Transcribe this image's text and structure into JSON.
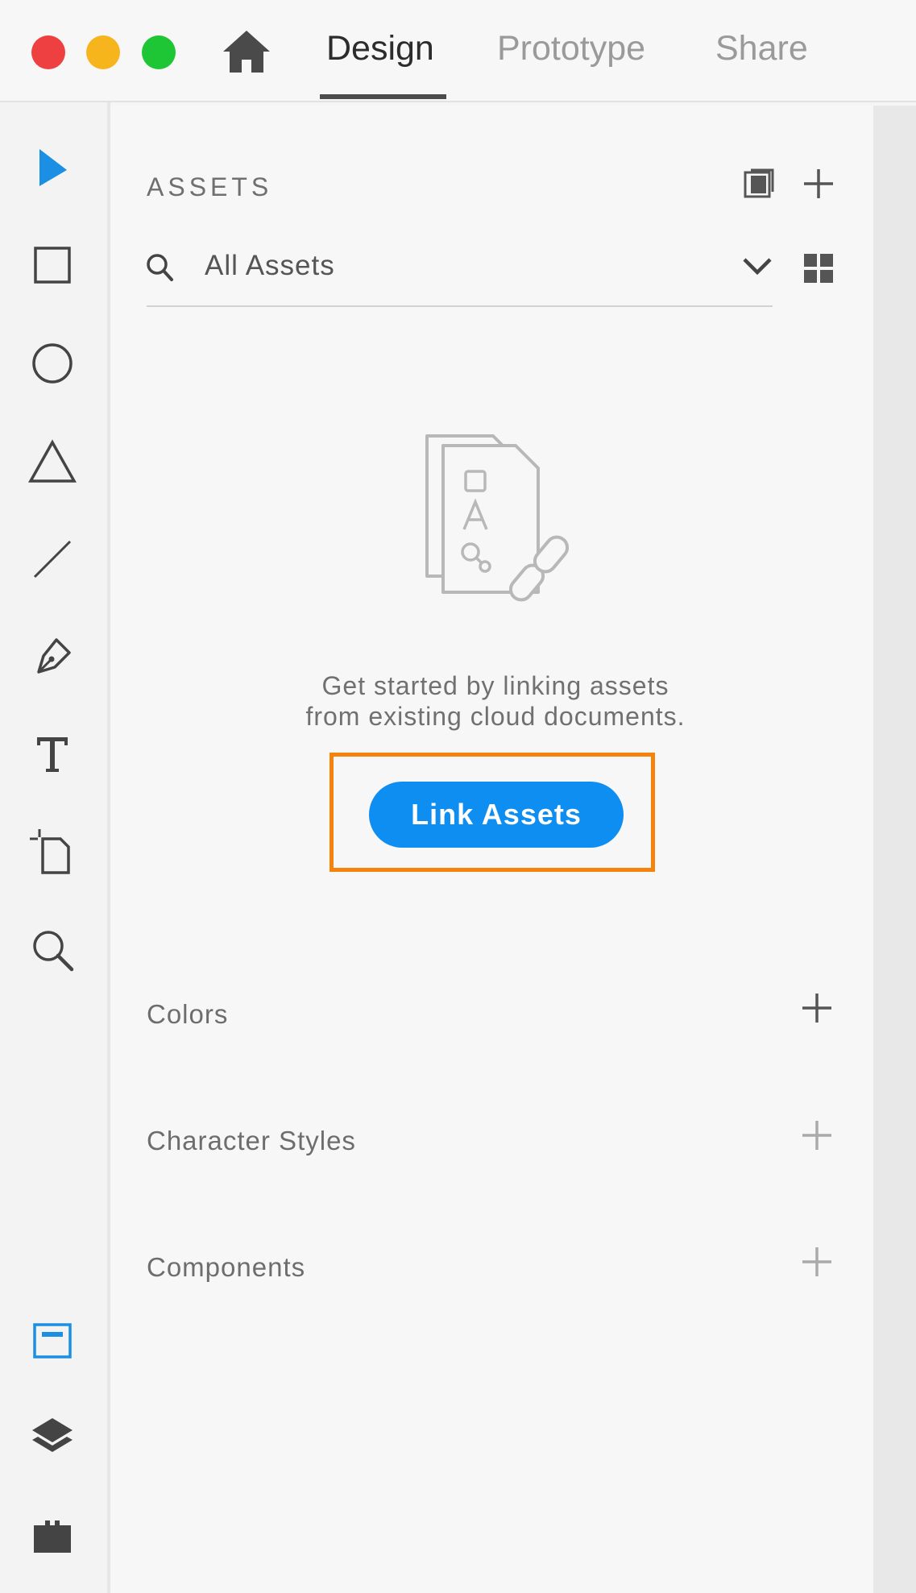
{
  "titlebar": {
    "tabs": [
      {
        "label": "Design",
        "active": true
      },
      {
        "label": "Prototype",
        "active": false
      },
      {
        "label": "Share",
        "active": false
      }
    ],
    "traffic_colors": {
      "close": "#ee4040",
      "minimize": "#f6b51c",
      "maximize": "#1ec636"
    }
  },
  "toolbar": {
    "tools": [
      "select-icon",
      "rectangle-icon",
      "ellipse-icon",
      "polygon-icon",
      "line-icon",
      "pen-icon",
      "text-icon",
      "artboard-icon",
      "zoom-icon"
    ],
    "bottom_tools": [
      "assets-panel-icon",
      "layers-icon",
      "plugins-icon"
    ],
    "accent_color": "#1a8fe3"
  },
  "assets": {
    "title": "ASSETS",
    "search": {
      "value": "All Assets"
    },
    "empty_message": {
      "line1": "Get started by linking assets",
      "line2": "from existing cloud documents."
    },
    "link_button": "Link Assets",
    "button_color": "#0d8ef0",
    "highlight_color": "#f5820a",
    "sections": [
      {
        "label": "Colors"
      },
      {
        "label": "Character Styles"
      },
      {
        "label": "Components"
      }
    ]
  }
}
